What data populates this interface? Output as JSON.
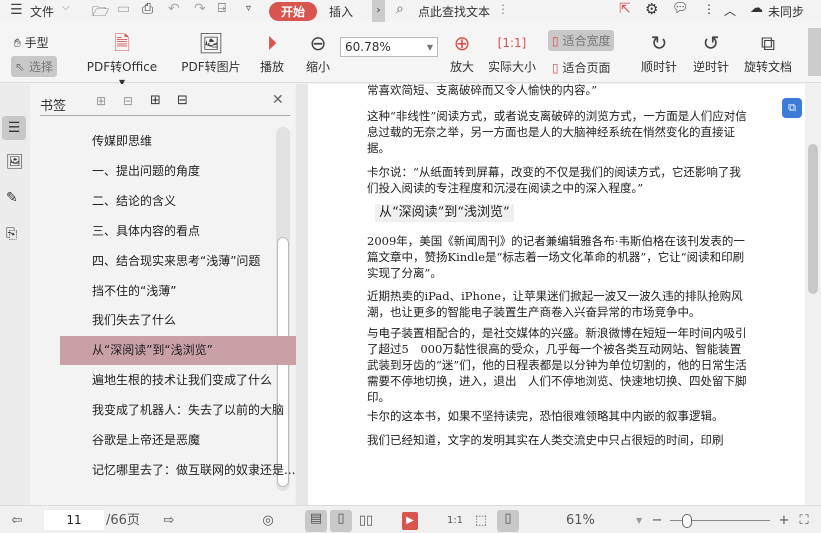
{
  "menu": {
    "file": "文件",
    "start": "开始",
    "insert": "插入",
    "search_placeholder": "点此查找文本",
    "sync": "未同步"
  },
  "toolbar": {
    "hand": "手型",
    "select": "选择",
    "pdf_office": "PDF转Office",
    "pdf_image": "PDF转图片",
    "play": "播放",
    "zoom_out": "缩小",
    "zoom_value": "60.78%",
    "zoom_in": "放大",
    "actual": "实际大小",
    "fit_width": "适合宽度",
    "fit_page": "适合页面",
    "cw": "顺时针",
    "ccw": "逆时针",
    "rotate": "旋转文档"
  },
  "bookmarks": {
    "title": "书签",
    "items": [
      "传媒即思维",
      "一、提出问题的角度",
      "二、结论的含义",
      "三、具体内容的看点",
      "四、结合现实来思考“浅薄”问题",
      "挡不住的“浅薄”",
      "我们失去了什么",
      "从“深阅读”到“浅浏览”",
      "遍地生根的技术让我们变成了什么",
      "我变成了机器人：失去了以前的大脑",
      "谷歌是上帝还是恶魔",
      "记忆哪里去了：做互联网的奴隶还是..."
    ],
    "selected": 7
  },
  "document": {
    "paragraphs": [
      "常喜欢简短、支离破碎而又令人愉快的内容。”",
      "这种“非线性”阅读方式，或者说支离破碎的浏览方式，一方面是人们应对信息过载的无奈之举，另一方面也是人的大脑神经系统在悄然变化的直接证据。",
      "卡尔说：“从纸面转到屏幕，改变的不仅是我们的阅读方式，它还影响了我们投入阅读的专注程度和沉浸在阅读之中的深入程度。”",
      "从“深阅读”到“浅浏览”",
      "2009年，美国《新闻周刊》的记者兼编辑雅各布·韦斯伯格在该刊发表的一篇文章中，赞扬Kindle是“标志着一场文化革命的机器”，它让“阅读和印刷实现了分离”。",
      "近期热卖的iPad、iPhone，让苹果迷们掀起一波又一波久违的排队抢购风潮，也让更多的智能电子装置生产商卷入兴奋异常的市场竞争中。",
      "与电子装置相配合的，是社交媒体的兴盛。新浪微博在短短一年时间内吸引了超过5　000万黏性很高的受众，几乎每一个被各类互动网站、智能装置武装到牙齿的“迷”们，他的日程表都是以分钟为单位切割的，他的日常生活需要不停地切换，进入，退出　人们不停地浏览、快速地切换、四处留下脚印。",
      "卡尔的这本书，如果不坚持读完，恐怕很难领略其中内嵌的叙事逻辑。",
      "我们已经知道，文字的发明其实在人类交流史中只占很短的时间，印刷"
    ]
  },
  "status": {
    "page": "11",
    "total": "/66页",
    "zoom": "61%"
  },
  "colors": {
    "accent": "#d9534f",
    "selected": "#c9a0a6"
  }
}
